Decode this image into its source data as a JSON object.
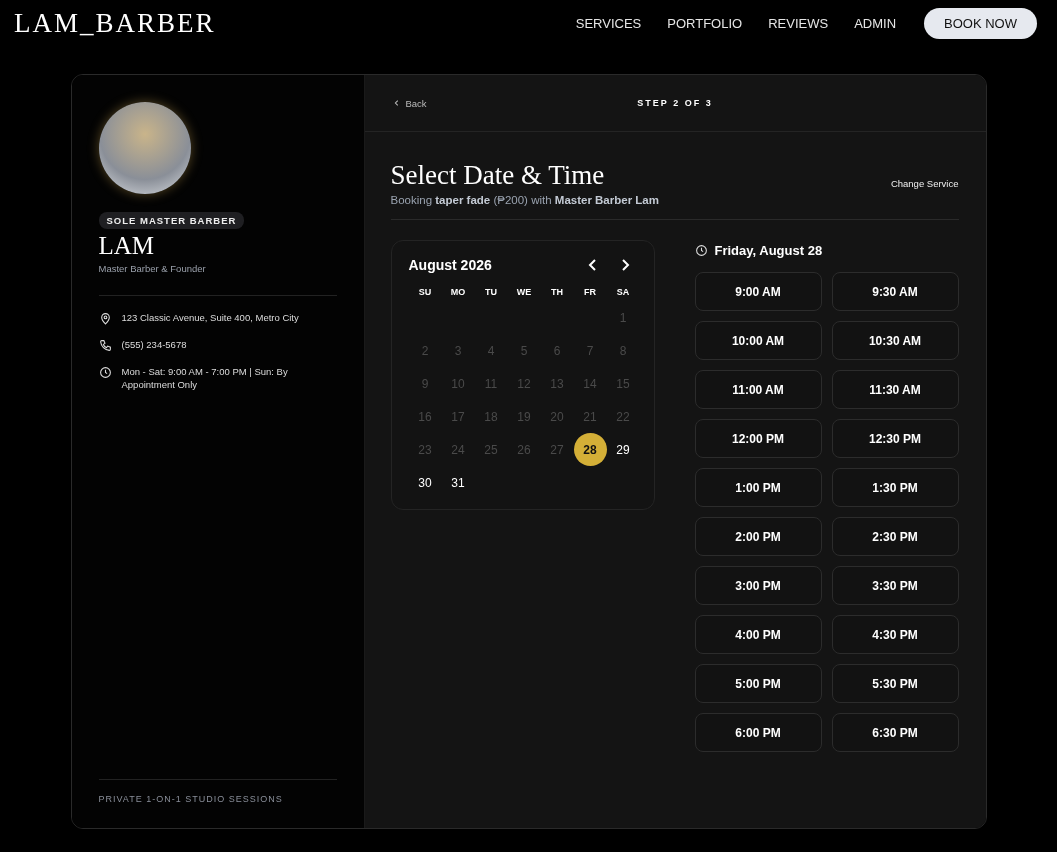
{
  "header": {
    "logo": "LAM_BARBER",
    "nav": [
      "SERVICES",
      "PORTFOLIO",
      "REVIEWS",
      "ADMIN"
    ],
    "cta": "BOOK NOW"
  },
  "profile": {
    "badge": "SOLE MASTER BARBER",
    "name": "LAM",
    "role": "Master Barber & Founder",
    "contacts": [
      {
        "kind": "location",
        "text": "123 Classic Avenue, Suite 400, Metro City"
      },
      {
        "kind": "phone",
        "text": "(555) 234-5678"
      },
      {
        "kind": "hours",
        "text": "Mon - Sat: 9:00 AM - 7:00 PM | Sun: By Appointment Only"
      }
    ],
    "footer": "PRIVATE 1-ON-1 STUDIO SESSIONS"
  },
  "booking": {
    "back": "Back",
    "step": "STEP 2 OF 3",
    "title": "Select Date & Time",
    "subtitle": "Booking **taper fade** (₱200) with **Master Barber Lam**",
    "change": "Change Service"
  },
  "calendar": {
    "month": "August 2026",
    "weekdays": [
      "SU",
      "MO",
      "TU",
      "WE",
      "TH",
      "FR",
      "SA"
    ],
    "weeks": [
      {
        "kind": "leading",
        "days": [
          {
            "day": "1",
            "disabled": true,
            "selected": false
          }
        ]
      },
      {
        "kind": "full",
        "days": [
          {
            "day": "2",
            "disabled": true,
            "selected": false
          },
          {
            "day": "3",
            "disabled": true,
            "selected": false
          },
          {
            "day": "4",
            "disabled": true,
            "selected": false
          },
          {
            "day": "5",
            "disabled": true,
            "selected": false
          },
          {
            "day": "6",
            "disabled": true,
            "selected": false
          },
          {
            "day": "7",
            "disabled": true,
            "selected": false
          },
          {
            "day": "8",
            "disabled": true,
            "selected": false
          }
        ]
      },
      {
        "kind": "full",
        "days": [
          {
            "day": "9",
            "disabled": true,
            "selected": false
          },
          {
            "day": "10",
            "disabled": true,
            "selected": false
          },
          {
            "day": "11",
            "disabled": true,
            "selected": false
          },
          {
            "day": "12",
            "disabled": true,
            "selected": false
          },
          {
            "day": "13",
            "disabled": true,
            "selected": false
          },
          {
            "day": "14",
            "disabled": true,
            "selected": false
          },
          {
            "day": "15",
            "disabled": true,
            "selected": false
          }
        ]
      },
      {
        "kind": "full",
        "days": [
          {
            "day": "16",
            "disabled": true,
            "selected": false
          },
          {
            "day": "17",
            "disabled": true,
            "selected": false
          },
          {
            "day": "18",
            "disabled": true,
            "selected": false
          },
          {
            "day": "19",
            "disabled": true,
            "selected": false
          },
          {
            "day": "20",
            "disabled": true,
            "selected": false
          },
          {
            "day": "21",
            "disabled": true,
            "selected": false
          },
          {
            "day": "22",
            "disabled": true,
            "selected": false
          }
        ]
      },
      {
        "kind": "full",
        "days": [
          {
            "day": "23",
            "disabled": true,
            "selected": false
          },
          {
            "day": "24",
            "disabled": true,
            "selected": false
          },
          {
            "day": "25",
            "disabled": true,
            "selected": false
          },
          {
            "day": "26",
            "disabled": true,
            "selected": false
          },
          {
            "day": "27",
            "disabled": true,
            "selected": false
          },
          {
            "day": "28",
            "disabled": false,
            "selected": true
          },
          {
            "day": "29",
            "disabled": false,
            "selected": false
          }
        ]
      },
      {
        "kind": "trailing",
        "days": [
          {
            "day": "30",
            "disabled": false,
            "selected": false
          },
          {
            "day": "31",
            "disabled": false,
            "selected": false
          }
        ]
      }
    ]
  },
  "times": {
    "date": "Friday, August 28",
    "slots": [
      "9:00 AM",
      "9:30 AM",
      "10:00 AM",
      "10:30 AM",
      "11:00 AM",
      "11:30 AM",
      "12:00 PM",
      "12:30 PM",
      "1:00 PM",
      "1:30 PM",
      "2:00 PM",
      "2:30 PM",
      "3:00 PM",
      "3:30 PM",
      "4:00 PM",
      "4:30 PM",
      "5:00 PM",
      "5:30 PM",
      "6:00 PM",
      "6:30 PM"
    ]
  }
}
